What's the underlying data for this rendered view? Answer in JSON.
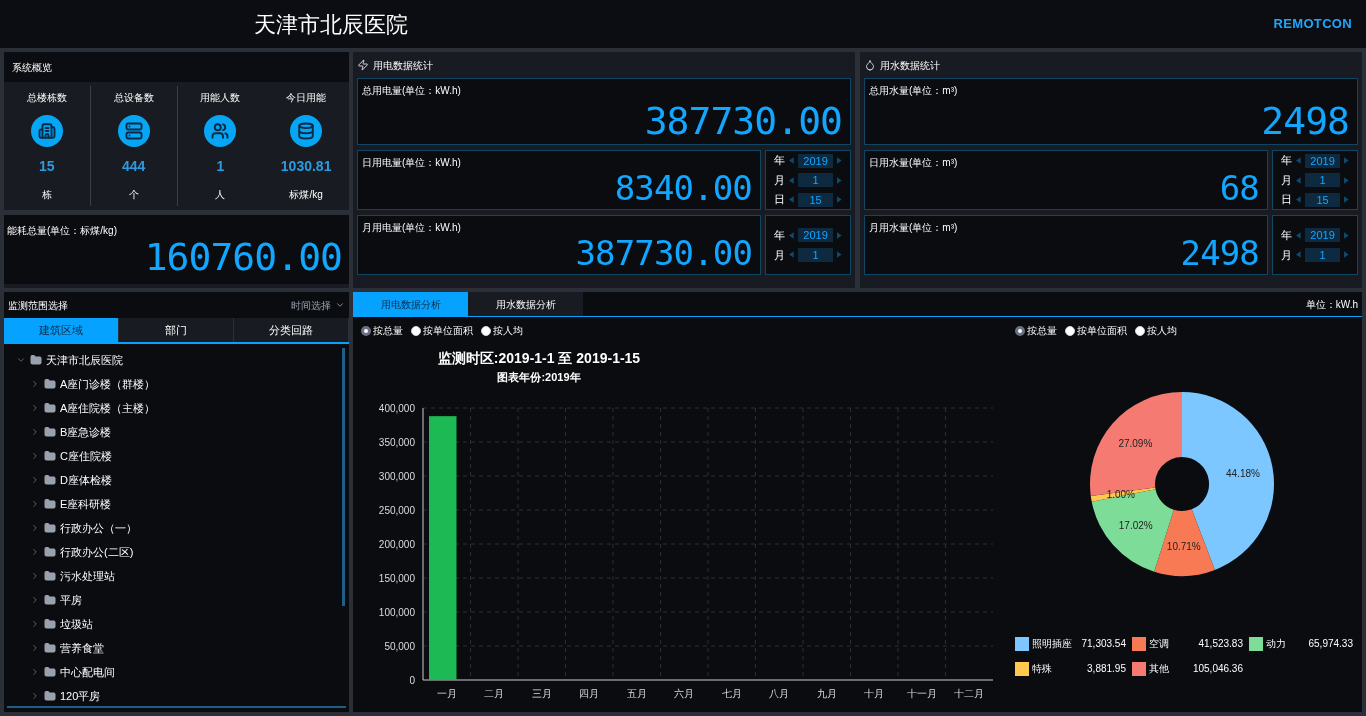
{
  "header": {
    "title": "天津市北辰医院",
    "logo": "REMOTCON"
  },
  "overview": {
    "title": "系统概览",
    "stats": [
      {
        "label": "总楼栋数",
        "value": "15",
        "unit": "栋"
      },
      {
        "label": "总设备数",
        "value": "444",
        "unit": "个"
      },
      {
        "label": "用能人数",
        "value": "1",
        "unit": "人"
      },
      {
        "label": "今日用能",
        "value": "1030.81",
        "unit": "标煤/kg"
      }
    ]
  },
  "energy_total": {
    "label": "能耗总量(单位：标煤/kg)",
    "value": "160760.00"
  },
  "electricity": {
    "title": "用电数据统计",
    "total": {
      "label": "总用电量(单位：kW.h)",
      "value": "387730.00"
    },
    "daily": {
      "label": "日用电量(单位：kW.h)",
      "value": "8340.00",
      "date": [
        {
          "unit": "年",
          "value": "2019"
        },
        {
          "unit": "月",
          "value": "1"
        },
        {
          "unit": "日",
          "value": "15"
        }
      ]
    },
    "monthly": {
      "label": "月用电量(单位：kW.h)",
      "value": "387730.00",
      "date": [
        {
          "unit": "年",
          "value": "2019"
        },
        {
          "unit": "月",
          "value": "1"
        }
      ]
    }
  },
  "water": {
    "title": "用水数据统计",
    "total": {
      "label": "总用水量(单位：m³)",
      "value": "2498"
    },
    "daily": {
      "label": "日用水量(单位：m³)",
      "value": "68",
      "date": [
        {
          "unit": "年",
          "value": "2019"
        },
        {
          "unit": "月",
          "value": "1"
        },
        {
          "unit": "日",
          "value": "15"
        }
      ]
    },
    "monthly": {
      "label": "月用水量(单位：m³)",
      "value": "2498",
      "date": [
        {
          "unit": "年",
          "value": "2019"
        },
        {
          "unit": "月",
          "value": "1"
        }
      ]
    }
  },
  "scope": {
    "title": "监测范围选择",
    "time_select": "时间选择",
    "tabs": [
      {
        "label": "建筑区域",
        "selected": true
      },
      {
        "label": "部门",
        "selected": false
      },
      {
        "label": "分类回路",
        "selected": false
      }
    ],
    "tree": [
      {
        "label": "天津市北辰医院",
        "expanded": true,
        "children": [
          {
            "label": "A座门诊楼（群楼）",
            "expanded": false
          },
          {
            "label": "A座住院楼（主楼）",
            "expanded": false
          },
          {
            "label": "B座急诊楼",
            "expanded": false
          },
          {
            "label": "C座住院楼",
            "expanded": false
          },
          {
            "label": "D座体检楼",
            "expanded": false
          },
          {
            "label": "E座科研楼",
            "expanded": false
          },
          {
            "label": "行政办公（一）",
            "expanded": false
          },
          {
            "label": "行政办公(二区)",
            "expanded": false
          },
          {
            "label": "污水处理站",
            "expanded": false
          },
          {
            "label": "平房",
            "expanded": false
          },
          {
            "label": "垃圾站",
            "expanded": false
          },
          {
            "label": "营养食堂",
            "expanded": false
          },
          {
            "label": "中心配电间",
            "expanded": false
          },
          {
            "label": "120平房",
            "expanded": false
          }
        ]
      }
    ]
  },
  "analysis": {
    "tabs": [
      {
        "label": "用电数据分析",
        "selected": true
      },
      {
        "label": "用水数据分析",
        "selected": false
      }
    ],
    "unit": "单位：kW.h",
    "bar_panel": {
      "options": [
        {
          "label": "按总量",
          "selected": true
        },
        {
          "label": "按单位面积",
          "selected": false
        },
        {
          "label": "按人均",
          "selected": false
        }
      ],
      "chart_data": {
        "type": "bar",
        "title": "监测时区:2019-1-1 至 2019-1-15",
        "subtitle": "图表年份:2019年",
        "categories": [
          "一月",
          "二月",
          "三月",
          "四月",
          "五月",
          "六月",
          "七月",
          "八月",
          "九月",
          "十月",
          "十一月",
          "十二月"
        ],
        "series": [
          {
            "color": "#1db954",
            "values": [
              388000,
              0,
              0,
              0,
              0,
              0,
              0,
              0,
              0,
              0,
              0,
              0
            ]
          }
        ],
        "grid": true,
        "ylim": [
          0,
          400000
        ],
        "yticks": [
          {
            "value": 0,
            "label": "0"
          },
          {
            "value": 50000,
            "label": "50,000"
          },
          {
            "value": 100000,
            "label": "100,000"
          },
          {
            "value": 150000,
            "label": "150,000"
          },
          {
            "value": 200000,
            "label": "200,000"
          },
          {
            "value": 250000,
            "label": "250,000"
          },
          {
            "value": 300000,
            "label": "300,000"
          },
          {
            "value": 350000,
            "label": "350,000"
          },
          {
            "value": 400000,
            "label": "400,000"
          }
        ]
      }
    },
    "pie_panel": {
      "options": [
        {
          "label": "按总量",
          "selected": true
        },
        {
          "label": "按单位面积",
          "selected": false
        },
        {
          "label": "按人均",
          "selected": false
        }
      ],
      "chart_data": {
        "type": "donut",
        "categories": [
          "照明插座",
          "空调",
          "动力",
          "特殊",
          "其他"
        ],
        "values": [
          44.18,
          10.71,
          17.02,
          1.0,
          27.09
        ],
        "value_labels": [
          "44.18%",
          "10.71%",
          "17.02%",
          "1.00%",
          "27.09%"
        ]
      },
      "legend": [
        {
          "value": "71,303.54",
          "color": "#7cc7ff"
        },
        {
          "value": "41,523.83",
          "color": "#f87a55"
        },
        {
          "value": "65,974.33",
          "color": "#7ddc98"
        },
        {
          "value": "3,881.95",
          "color": "#ffc94f"
        },
        {
          "value": "105,046.36",
          "color": "#f47a72"
        }
      ]
    }
  }
}
